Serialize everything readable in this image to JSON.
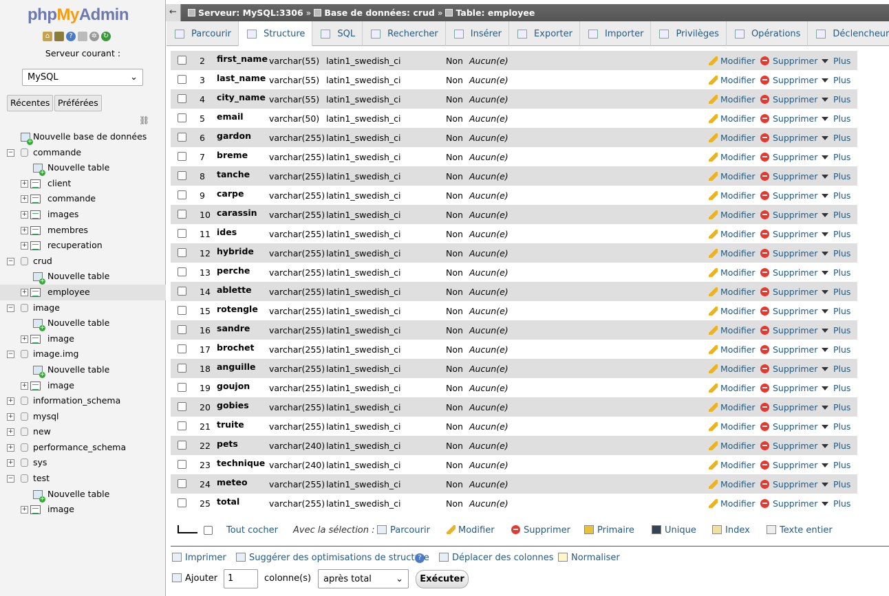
{
  "logo": {
    "php": "php",
    "my": "My",
    "admin": "Admin"
  },
  "nav": {
    "server_label": "Serveur courant :",
    "server_value": "MySQL",
    "recent": "Récentes",
    "favorites": "Préférées",
    "tree": [
      {
        "label": "Nouvelle base de données",
        "level": 1,
        "kind": "new"
      },
      {
        "label": "commande",
        "level": 0,
        "kind": "db"
      },
      {
        "label": "Nouvelle table",
        "level": 2,
        "kind": "new"
      },
      {
        "label": "client",
        "level": 1,
        "kind": "table"
      },
      {
        "label": "commande",
        "level": 1,
        "kind": "table"
      },
      {
        "label": "images",
        "level": 1,
        "kind": "table"
      },
      {
        "label": "membres",
        "level": 1,
        "kind": "table"
      },
      {
        "label": "recuperation",
        "level": 1,
        "kind": "table"
      },
      {
        "label": "crud",
        "level": 0,
        "kind": "db"
      },
      {
        "label": "Nouvelle table",
        "level": 2,
        "kind": "new"
      },
      {
        "label": "employee",
        "level": 1,
        "kind": "table",
        "selected": true
      },
      {
        "label": "image",
        "level": 0,
        "kind": "db"
      },
      {
        "label": "Nouvelle table",
        "level": 2,
        "kind": "new"
      },
      {
        "label": "image",
        "level": 1,
        "kind": "table"
      },
      {
        "label": "image.img",
        "level": 0,
        "kind": "db"
      },
      {
        "label": "Nouvelle table",
        "level": 2,
        "kind": "new"
      },
      {
        "label": "image",
        "level": 1,
        "kind": "table"
      },
      {
        "label": "information_schema",
        "level": 0,
        "kind": "dbclosed"
      },
      {
        "label": "mysql",
        "level": 0,
        "kind": "dbclosed"
      },
      {
        "label": "new",
        "level": 0,
        "kind": "dbclosed"
      },
      {
        "label": "performance_schema",
        "level": 0,
        "kind": "dbclosed"
      },
      {
        "label": "sys",
        "level": 0,
        "kind": "dbclosed"
      },
      {
        "label": "test",
        "level": 0,
        "kind": "db"
      },
      {
        "label": "Nouvelle table",
        "level": 2,
        "kind": "new"
      },
      {
        "label": "image",
        "level": 1,
        "kind": "table"
      }
    ]
  },
  "breadcrumb": {
    "server": "Serveur: MySQL:3306",
    "database": "Base de données: crud",
    "table": "Table: employee",
    "separator": "»"
  },
  "tabs": [
    {
      "label": "Parcourir",
      "icon": "browse-icon"
    },
    {
      "label": "Structure",
      "icon": "structure-icon",
      "active": true
    },
    {
      "label": "SQL",
      "icon": "sql-icon"
    },
    {
      "label": "Rechercher",
      "icon": "search-icon"
    },
    {
      "label": "Insérer",
      "icon": "insert-icon"
    },
    {
      "label": "Exporter",
      "icon": "export-icon"
    },
    {
      "label": "Importer",
      "icon": "import-icon"
    },
    {
      "label": "Privilèges",
      "icon": "privileges-icon"
    },
    {
      "label": "Opérations",
      "icon": "wrench-icon"
    },
    {
      "label": "Déclencheurs",
      "icon": "triggers-icon"
    }
  ],
  "actions": {
    "modify": "Modifier",
    "delete": "Supprimer",
    "more": "Plus"
  },
  "columns": [
    {
      "n": "2",
      "name": "first_name",
      "type": "varchar(55)",
      "collation": "latin1_swedish_ci",
      "null": "Non",
      "default": "Aucun(e)"
    },
    {
      "n": "3",
      "name": "last_name",
      "type": "varchar(55)",
      "collation": "latin1_swedish_ci",
      "null": "Non",
      "default": "Aucun(e)"
    },
    {
      "n": "4",
      "name": "city_name",
      "type": "varchar(55)",
      "collation": "latin1_swedish_ci",
      "null": "Non",
      "default": "Aucun(e)"
    },
    {
      "n": "5",
      "name": "email",
      "type": "varchar(50)",
      "collation": "latin1_swedish_ci",
      "null": "Non",
      "default": "Aucun(e)"
    },
    {
      "n": "6",
      "name": "gardon",
      "type": "varchar(255)",
      "collation": "latin1_swedish_ci",
      "null": "Non",
      "default": "Aucun(e)"
    },
    {
      "n": "7",
      "name": "breme",
      "type": "varchar(255)",
      "collation": "latin1_swedish_ci",
      "null": "Non",
      "default": "Aucun(e)"
    },
    {
      "n": "8",
      "name": "tanche",
      "type": "varchar(255)",
      "collation": "latin1_swedish_ci",
      "null": "Non",
      "default": "Aucun(e)"
    },
    {
      "n": "9",
      "name": "carpe",
      "type": "varchar(255)",
      "collation": "latin1_swedish_ci",
      "null": "Non",
      "default": "Aucun(e)"
    },
    {
      "n": "10",
      "name": "carassin",
      "type": "varchar(255)",
      "collation": "latin1_swedish_ci",
      "null": "Non",
      "default": "Aucun(e)"
    },
    {
      "n": "11",
      "name": "ides",
      "type": "varchar(255)",
      "collation": "latin1_swedish_ci",
      "null": "Non",
      "default": "Aucun(e)"
    },
    {
      "n": "12",
      "name": "hybride",
      "type": "varchar(255)",
      "collation": "latin1_swedish_ci",
      "null": "Non",
      "default": "Aucun(e)"
    },
    {
      "n": "13",
      "name": "perche",
      "type": "varchar(255)",
      "collation": "latin1_swedish_ci",
      "null": "Non",
      "default": "Aucun(e)"
    },
    {
      "n": "14",
      "name": "ablette",
      "type": "varchar(255)",
      "collation": "latin1_swedish_ci",
      "null": "Non",
      "default": "Aucun(e)"
    },
    {
      "n": "15",
      "name": "rotengle",
      "type": "varchar(255)",
      "collation": "latin1_swedish_ci",
      "null": "Non",
      "default": "Aucun(e)"
    },
    {
      "n": "16",
      "name": "sandre",
      "type": "varchar(255)",
      "collation": "latin1_swedish_ci",
      "null": "Non",
      "default": "Aucun(e)"
    },
    {
      "n": "17",
      "name": "brochet",
      "type": "varchar(255)",
      "collation": "latin1_swedish_ci",
      "null": "Non",
      "default": "Aucun(e)"
    },
    {
      "n": "18",
      "name": "anguille",
      "type": "varchar(255)",
      "collation": "latin1_swedish_ci",
      "null": "Non",
      "default": "Aucun(e)"
    },
    {
      "n": "19",
      "name": "goujon",
      "type": "varchar(255)",
      "collation": "latin1_swedish_ci",
      "null": "Non",
      "default": "Aucun(e)"
    },
    {
      "n": "20",
      "name": "gobies",
      "type": "varchar(255)",
      "collation": "latin1_swedish_ci",
      "null": "Non",
      "default": "Aucun(e)"
    },
    {
      "n": "21",
      "name": "truite",
      "type": "varchar(255)",
      "collation": "latin1_swedish_ci",
      "null": "Non",
      "default": "Aucun(e)"
    },
    {
      "n": "22",
      "name": "pets",
      "type": "varchar(240)",
      "collation": "latin1_swedish_ci",
      "null": "Non",
      "default": "Aucun(e)"
    },
    {
      "n": "23",
      "name": "technique",
      "type": "varchar(240)",
      "collation": "latin1_swedish_ci",
      "null": "Non",
      "default": "Aucun(e)"
    },
    {
      "n": "24",
      "name": "meteo",
      "type": "varchar(255)",
      "collation": "latin1_swedish_ci",
      "null": "Non",
      "default": "Aucun(e)"
    },
    {
      "n": "25",
      "name": "total",
      "type": "varchar(255)",
      "collation": "latin1_swedish_ci",
      "null": "Non",
      "default": "Aucun(e)"
    }
  ],
  "bulk": {
    "check_all": "Tout cocher",
    "with_selection": "Avec la sélection :",
    "browse": "Parcourir",
    "modify": "Modifier",
    "delete": "Supprimer",
    "primary": "Primaire",
    "unique": "Unique",
    "index": "Index",
    "fulltext": "Texte entier"
  },
  "bottom": {
    "print": "Imprimer",
    "suggest": "Suggérer des optimisations de structure",
    "move": "Déplacer des colonnes",
    "normalize": "Normaliser",
    "add": "Ajouter",
    "add_count": "1",
    "columns": "colonne(s)",
    "position": "après total",
    "execute": "Exécuter"
  },
  "colors": {
    "link": "#235a81",
    "row_alt": "#dfdfdf",
    "delete": "#e8382e"
  }
}
